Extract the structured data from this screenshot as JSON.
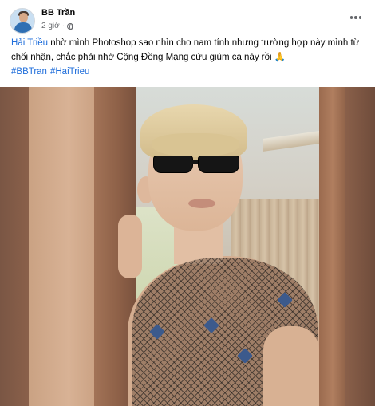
{
  "post": {
    "author": "BB Trần",
    "timestamp": "2 giờ",
    "privacy_icon": "globe-icon",
    "more_icon": "more-horizontal-icon",
    "caption": {
      "mention": "Hải Triều",
      "text": " nhờ mình Photoshop sao nhìn cho nam tính nhưng trường hợp này mình từ chối nhận, chắc phải nhờ Cộng Đồng Mạng cứu giùm ca này rồi 🙏"
    },
    "hashtags": [
      "#BBTran",
      "#HaiTrieu"
    ]
  },
  "colors": {
    "link": "#216fdb",
    "meta_text": "#65676b",
    "author_text": "#050505"
  }
}
